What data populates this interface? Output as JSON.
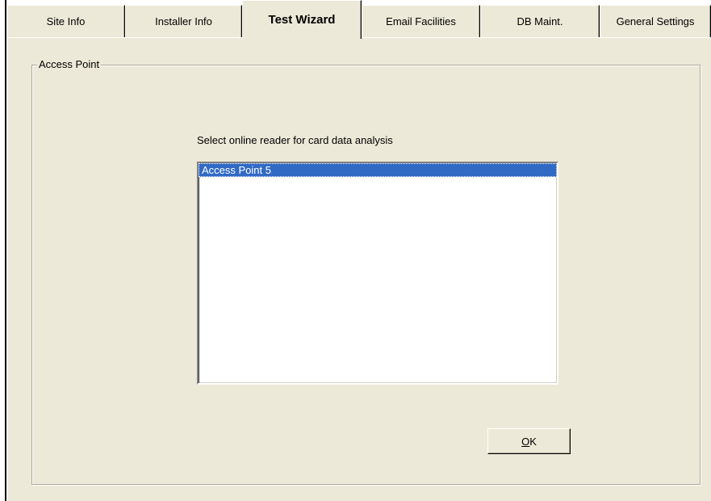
{
  "tabs": [
    {
      "label": "Site Info",
      "active": false
    },
    {
      "label": "Installer Info",
      "active": false
    },
    {
      "label": "Test Wizard",
      "active": true
    },
    {
      "label": "Email Facilities",
      "active": false
    },
    {
      "label": "DB Maint.",
      "active": false
    },
    {
      "label": "General Settings",
      "active": false
    }
  ],
  "group": {
    "title": "Access Point"
  },
  "instruction": "Select online reader for card data analysis",
  "reader_list": {
    "items": [
      {
        "label": "Access Point 5",
        "selected": true
      }
    ]
  },
  "ok_button": {
    "mnemonic": "O",
    "rest": "K"
  },
  "colors": {
    "face": "#ece9d8",
    "selection": "#316ac5",
    "border_dark": "#aca899"
  }
}
